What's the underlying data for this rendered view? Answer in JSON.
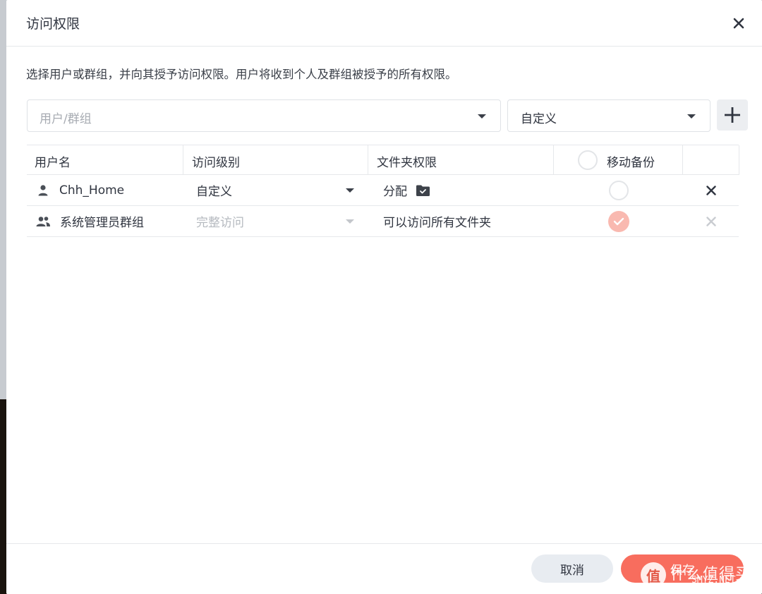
{
  "dialog": {
    "title": "访问权限",
    "description": "选择用户或群组，并向其授予访问权限。用户将收到个人及群组被授予的所有权限。"
  },
  "toolbar": {
    "user_select_placeholder": "用户/群组",
    "level_select_value": "自定义"
  },
  "table": {
    "headers": {
      "username": "用户名",
      "access_level": "访问级别",
      "folder_permission": "文件夹权限",
      "mobile_backup": "移动备份"
    },
    "rows": [
      {
        "name": "Chh_Home",
        "icon": "user-icon",
        "level": "自定义",
        "permission": "分配",
        "backup_checked": false
      },
      {
        "name": "系统管理员群组",
        "icon": "group-icon",
        "level": "完整访问",
        "permission": "可以访问所有文件夹",
        "backup_checked": true
      }
    ]
  },
  "footer": {
    "cancel_label": "取消",
    "save_label": "保存"
  },
  "watermark": {
    "logo_glyph": "值",
    "text": "什么值得买",
    "sub": "SMYZ.NET"
  },
  "colors": {
    "primary": "#f86d5e",
    "check_fill": "#f9b9b0",
    "border": "#e6e8eb"
  }
}
